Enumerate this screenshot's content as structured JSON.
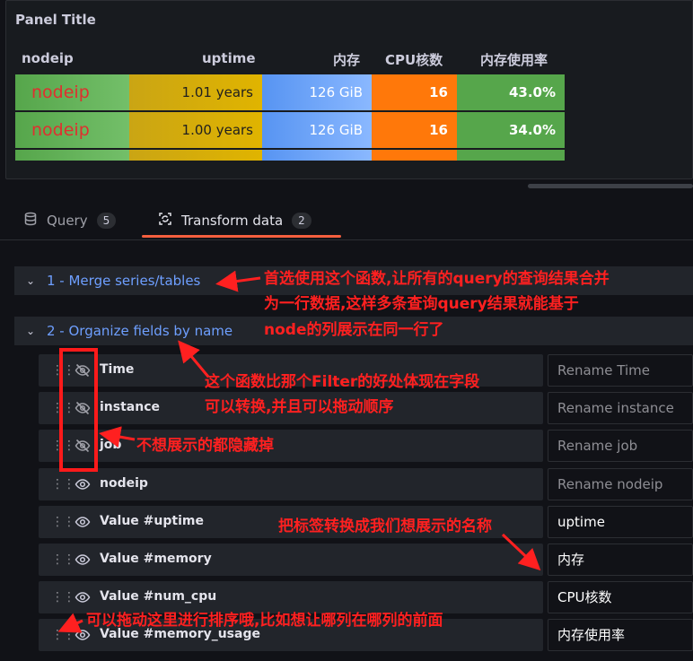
{
  "panel": {
    "title": "Panel Title",
    "columns": [
      "nodeip",
      "uptime",
      "内存",
      "CPU核数",
      "内存使用率"
    ],
    "rows": [
      {
        "nodeip": "nodeip",
        "uptime": "1.01 years",
        "memory": "126 GiB",
        "cpu": "16",
        "usage": "43.0%"
      },
      {
        "nodeip": "nodeip",
        "uptime": "1.00 years",
        "memory": "126 GiB",
        "cpu": "16",
        "usage": "34.0%"
      }
    ]
  },
  "tabs": {
    "query": {
      "label": "Query",
      "count": "5"
    },
    "transform": {
      "label": "Transform data",
      "count": "2"
    }
  },
  "transformations": {
    "merge": {
      "label": "1 - Merge series/tables"
    },
    "organize": {
      "label": "2 - Organize fields by name",
      "fields": [
        {
          "name": "Time",
          "hidden": true,
          "rename": "Rename Time",
          "is_placeholder": true
        },
        {
          "name": "instance",
          "hidden": true,
          "rename": "Rename instance",
          "is_placeholder": true
        },
        {
          "name": "job",
          "hidden": true,
          "rename": "Rename job",
          "is_placeholder": true
        },
        {
          "name": "nodeip",
          "hidden": false,
          "rename": "Rename nodeip",
          "is_placeholder": true
        },
        {
          "name": "Value #uptime",
          "hidden": false,
          "rename": "uptime",
          "is_placeholder": false
        },
        {
          "name": "Value #memory",
          "hidden": false,
          "rename": "内存",
          "is_placeholder": false
        },
        {
          "name": "Value #num_cpu",
          "hidden": false,
          "rename": "CPU核数",
          "is_placeholder": false
        },
        {
          "name": "Value #memory_usage",
          "hidden": false,
          "rename": "内存使用率",
          "is_placeholder": false
        }
      ]
    }
  },
  "annotations": {
    "merge_note_1": "首选使用这个函数,让所有的query的查询结果合并",
    "merge_note_2": "为一行数据,这样多条查询query结果就能基于",
    "merge_note_3": "node的列展示在同一行了",
    "organize_note_1": "这个函数比那个Filter的好处体现在字段",
    "organize_note_2": "可以转换,并且可以拖动顺序",
    "hide_note": "不想展示的都隐藏掉",
    "rename_note": "把标签转换成我们想展示的名称",
    "drag_note": "可以拖动这里进行排序哦,比如想让哪列在哪列的前面"
  },
  "colors": {
    "accent_tab": "#f55f3e",
    "annotation": "#ff2020",
    "link_blue": "#6e9fff"
  }
}
